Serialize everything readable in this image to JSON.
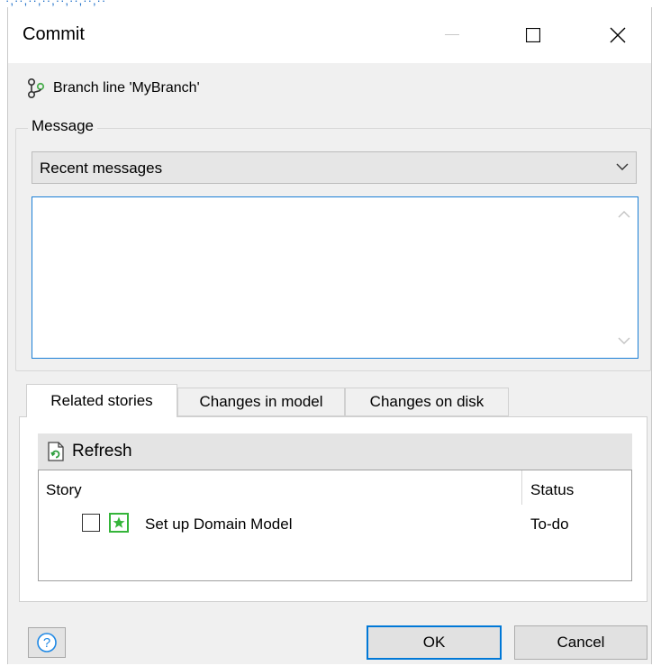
{
  "top_strip_text": "·,··,··,··,··,··,··,··",
  "window": {
    "title": "Commit"
  },
  "branch": {
    "label": "Branch line 'MyBranch'",
    "icon": "branch-icon"
  },
  "message": {
    "legend": "Message",
    "recent_combo_value": "Recent messages",
    "text": ""
  },
  "tabs": [
    {
      "label": "Related stories",
      "active": true
    },
    {
      "label": "Changes in model",
      "active": false
    },
    {
      "label": "Changes on disk",
      "active": false
    }
  ],
  "toolbar": {
    "refresh_label": "Refresh"
  },
  "stories": {
    "columns": [
      "Story",
      "Status"
    ],
    "rows": [
      {
        "checked": false,
        "name": "Set up Domain Model",
        "status": "To-do",
        "icon": "star-story-icon"
      }
    ]
  },
  "buttons": {
    "ok": "OK",
    "cancel": "Cancel",
    "help_icon": "help-icon"
  },
  "colors": {
    "accent": "#0078d7",
    "story_green": "#35b53a",
    "branch_green": "#4caf50"
  }
}
